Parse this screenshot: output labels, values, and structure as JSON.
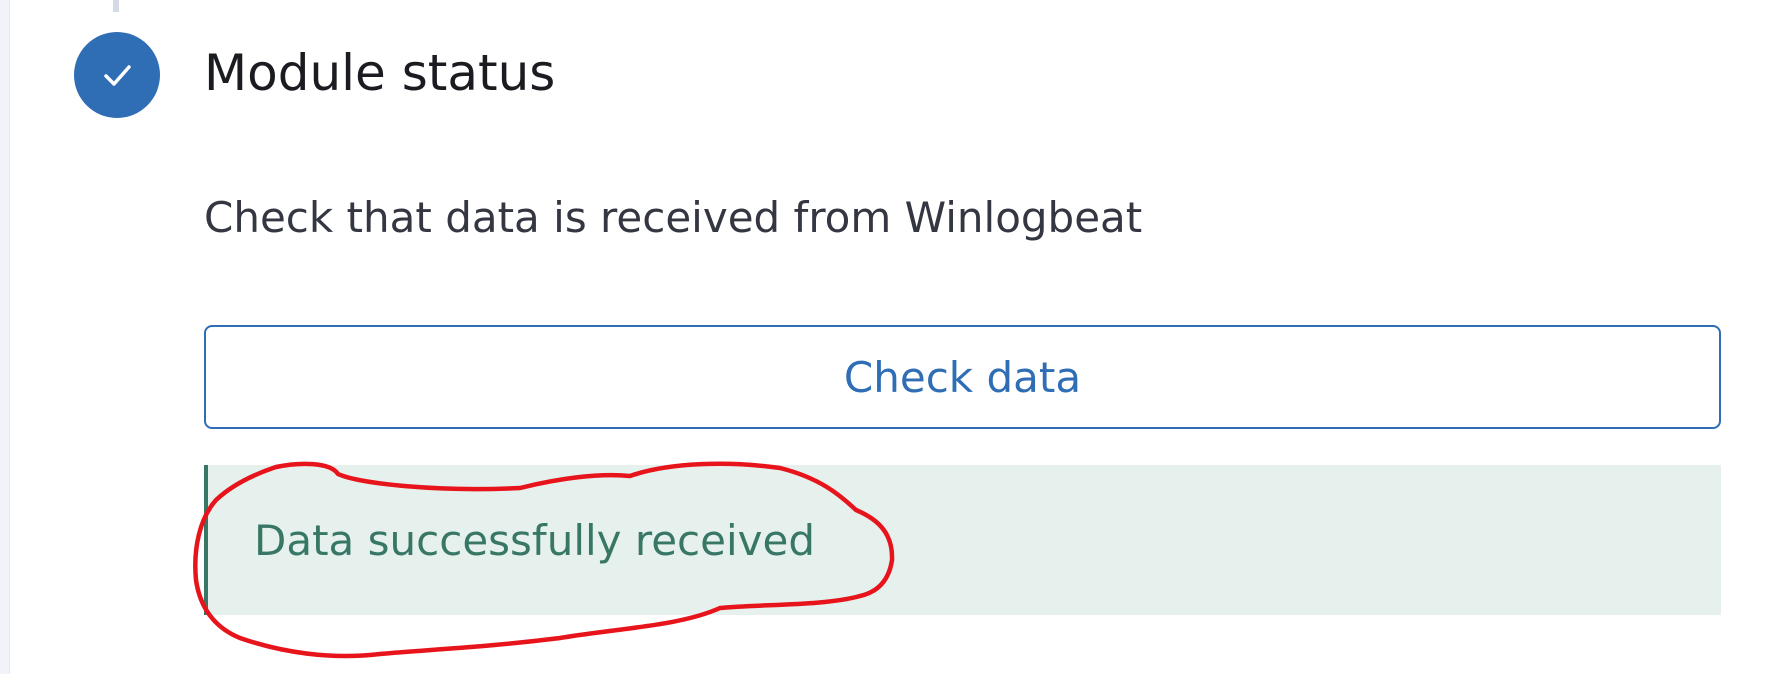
{
  "step": {
    "title": "Module status",
    "status": "complete",
    "status_icon": "check-icon",
    "accent_color": "#2f6db5"
  },
  "description": "Check that data is received from Winlogbeat",
  "check_button": {
    "label": "Check data"
  },
  "result_callout": {
    "message": "Data successfully received",
    "color": "#387765",
    "background": "#e6f1ee"
  },
  "annotation": {
    "type": "hand-drawn-circle",
    "color": "#e8141b"
  }
}
